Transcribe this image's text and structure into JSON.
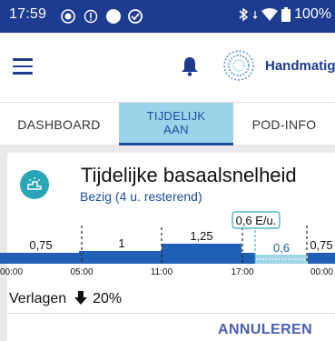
{
  "status_bar": {
    "time": "17:59",
    "battery": "100%",
    "icons": [
      "circle-dot-icon",
      "info-circle-icon",
      "record-icon",
      "no-disturb-icon",
      "bluetooth-icon",
      "wifi-icon",
      "battery-icon"
    ]
  },
  "app_bar": {
    "mode_label": "Handmatig",
    "icons": [
      "menu-icon",
      "bell-icon",
      "activity-sun-icon"
    ]
  },
  "tabs": [
    {
      "label": "DASHBOARD",
      "active": false
    },
    {
      "label": "TIJDELIJK AAN",
      "line1": "TIJDELIJK",
      "line2": "AAN",
      "active": true
    },
    {
      "label": "POD-INFO",
      "active": false
    }
  ],
  "card": {
    "title": "Tijdelijke basaalsnelheid",
    "status": "Bezig (4 u. resterend)",
    "temp_rate_label": "0,6 E/u.",
    "segments": [
      {
        "value": "0,75"
      },
      {
        "value": "1"
      },
      {
        "value": "1,25"
      },
      {
        "value": "0,6"
      },
      {
        "value": "0,75"
      }
    ],
    "time_ticks": [
      "00:00",
      "05:00",
      "11:00",
      "17:00",
      "00:00"
    ],
    "reduce_label": "Verlagen",
    "reduce_value": "20%",
    "cancel_label": "ANNULEREN"
  },
  "colors": {
    "status_bar": "#1d3b8f",
    "brand_blue": "#1d3b8f",
    "active_tab": "#9dd3ea",
    "icon_teal": "#2aa6b8",
    "basal_bar": "#1f5fb5",
    "temp_basal": "#9fd6e4"
  }
}
